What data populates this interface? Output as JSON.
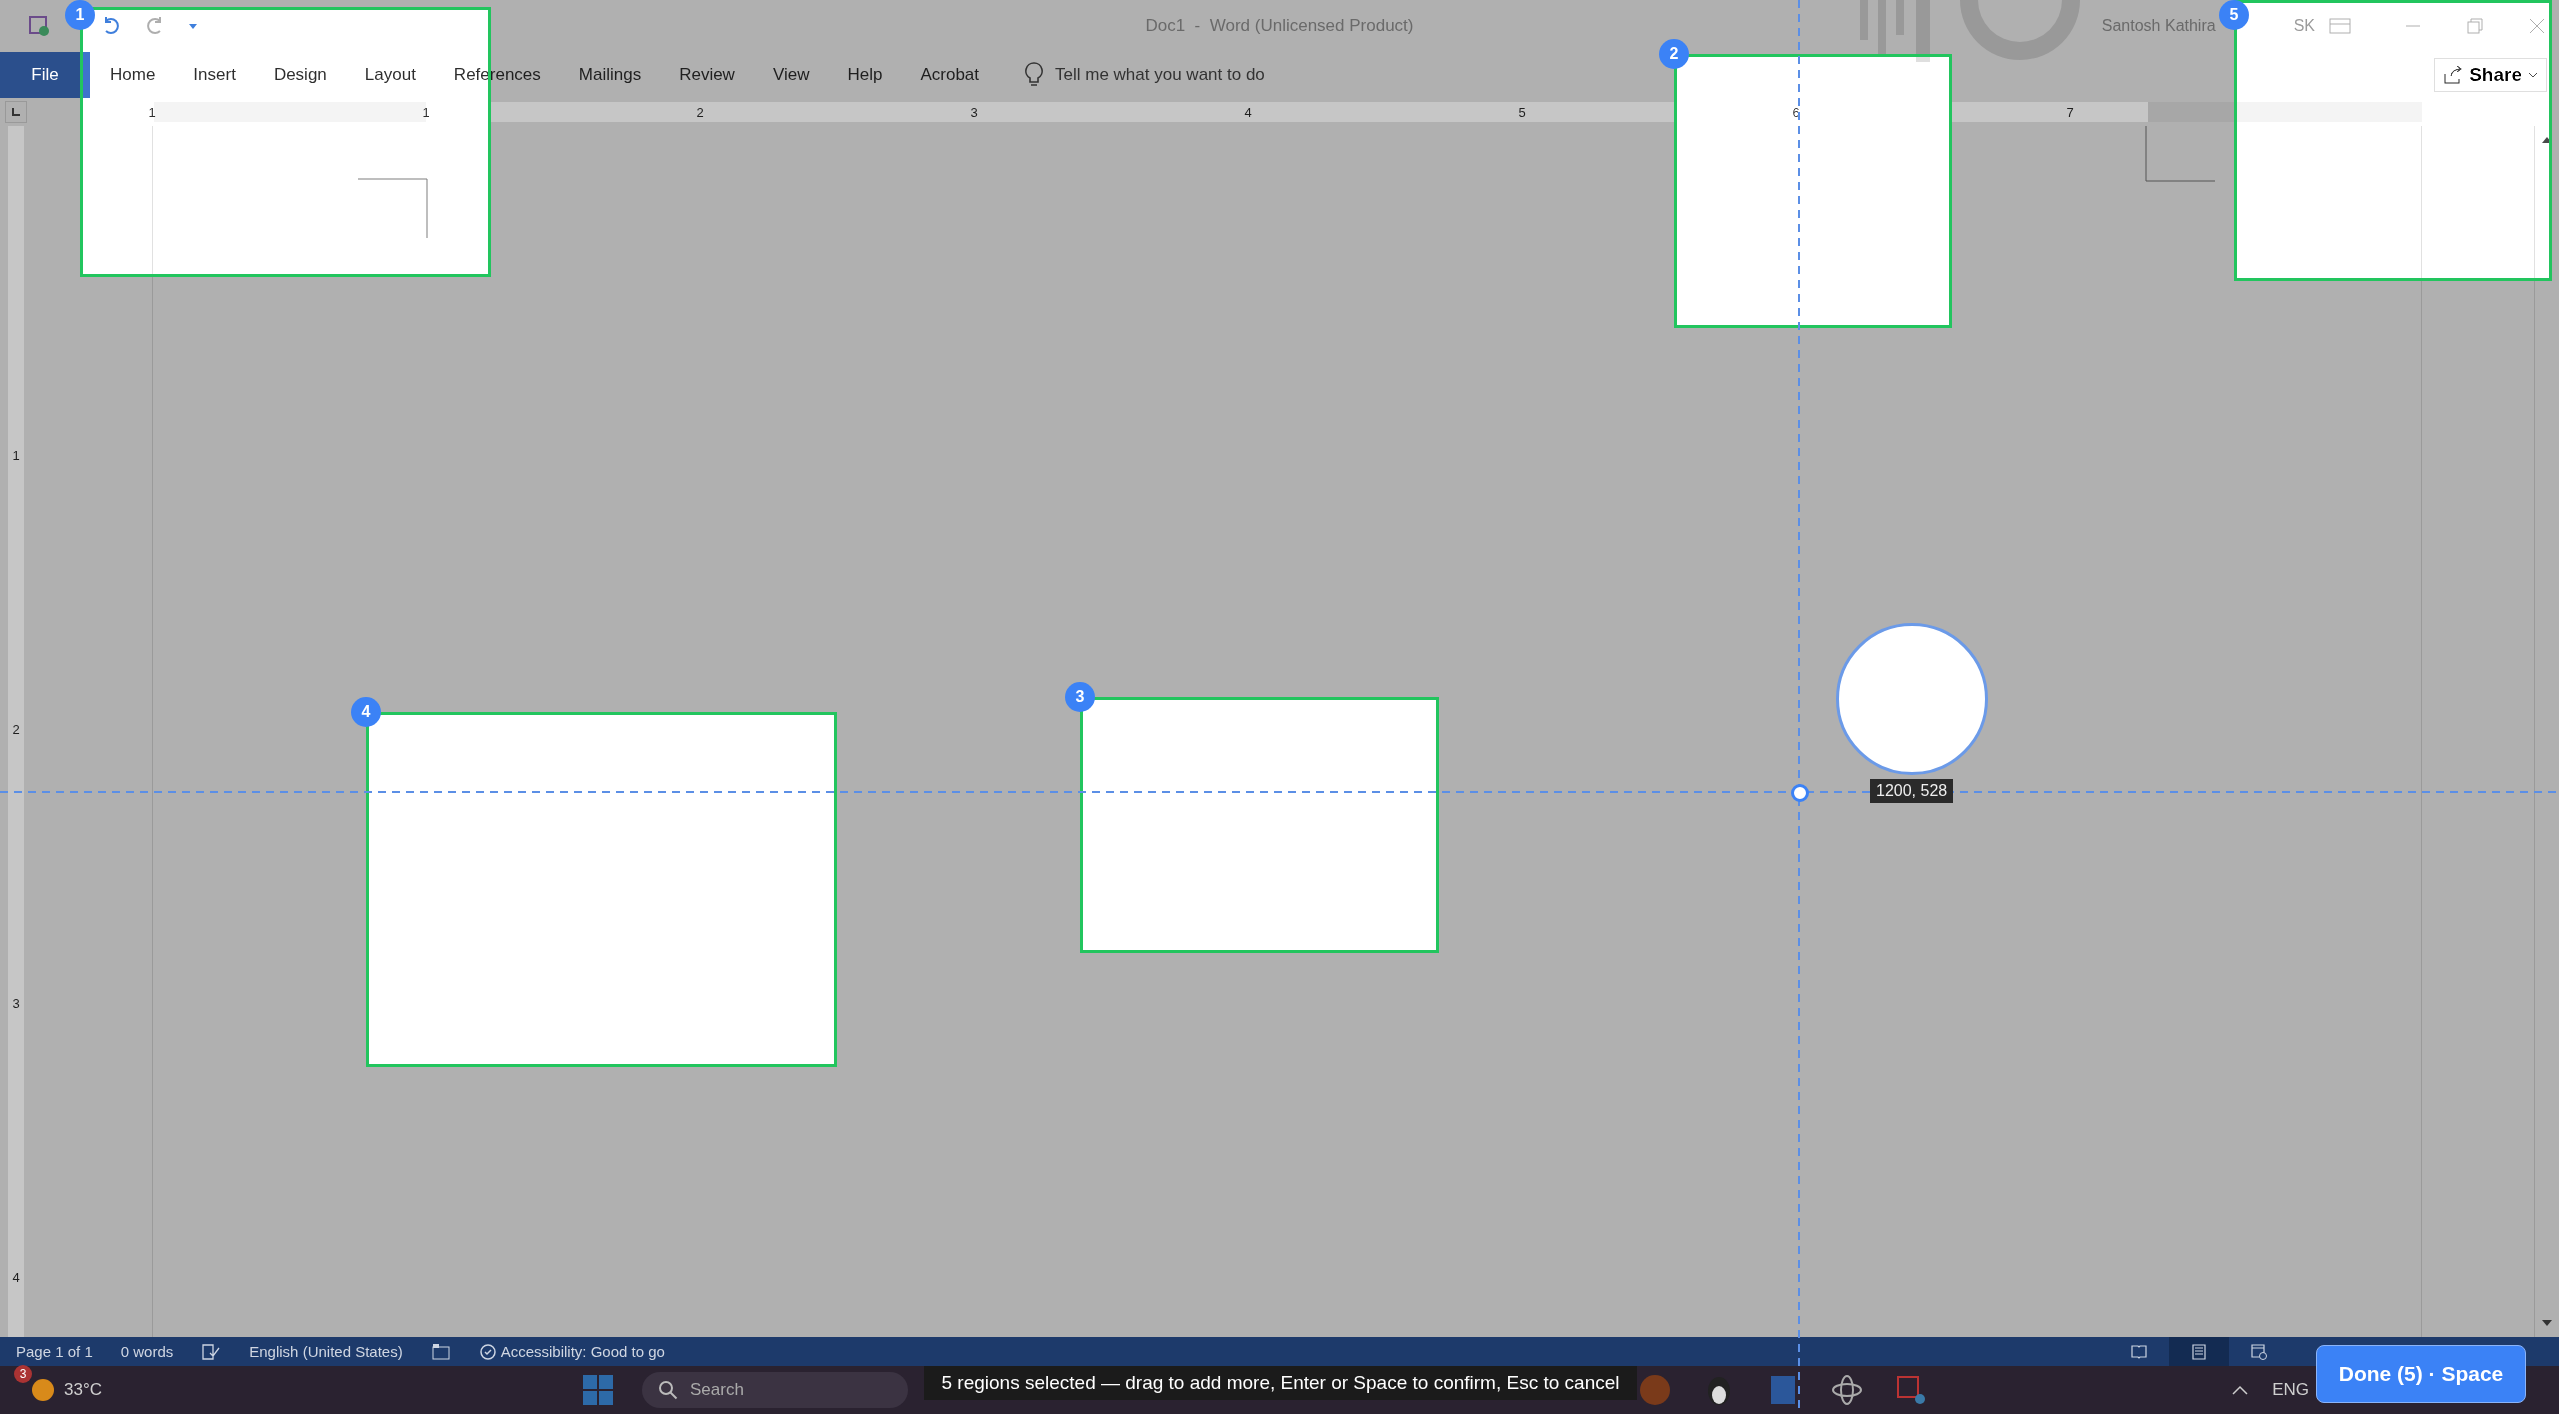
{
  "title_bar": {
    "title": "Doc1  -  Word (Unlicensed Product)",
    "user_name": "Santosh Kathira",
    "user_initials": "SK"
  },
  "ribbon_tabs": [
    {
      "label": "File",
      "kind": "backstage"
    },
    {
      "label": "Home",
      "kind": "tab"
    },
    {
      "label": "Insert",
      "kind": "tab"
    },
    {
      "label": "Design",
      "kind": "tab"
    },
    {
      "label": "Layout",
      "kind": "tab"
    },
    {
      "label": "References",
      "kind": "tab"
    },
    {
      "label": "Mailings",
      "kind": "tab"
    },
    {
      "label": "Review",
      "kind": "tab"
    },
    {
      "label": "View",
      "kind": "tab"
    },
    {
      "label": "Help",
      "kind": "tab"
    },
    {
      "label": "Acrobat",
      "kind": "tab"
    }
  ],
  "tell_me": {
    "placeholder": "Tell me what you want to do"
  },
  "share_button": "Share",
  "horizontal_ruler": [
    "1",
    "1",
    "2",
    "3",
    "4",
    "5",
    "6",
    "7"
  ],
  "vertical_ruler": [
    "1",
    "2",
    "3",
    "4"
  ],
  "status_bar": {
    "page": "Page 1 of 1",
    "words": "0 words",
    "language": "English (United States)",
    "accessibility": "Accessibility: Good to go",
    "views": [
      {
        "kind": "read",
        "selected": false
      },
      {
        "kind": "print",
        "selected": true
      },
      {
        "kind": "web",
        "selected": false
      }
    ]
  },
  "taskbar": {
    "weather_badge": "3",
    "temperature": "33°C",
    "search": {
      "placeholder": "Search"
    },
    "language": "ENG"
  },
  "overlay": {
    "regions": [
      {
        "number": "1"
      },
      {
        "number": "2"
      },
      {
        "number": "3"
      },
      {
        "number": "4"
      },
      {
        "number": "5"
      }
    ],
    "cursor_readout": "1200, 528",
    "hint": "5 regions selected — drag to add more, Enter or Space to confirm, Esc to cancel",
    "done_button": "Done (5) · Space"
  }
}
